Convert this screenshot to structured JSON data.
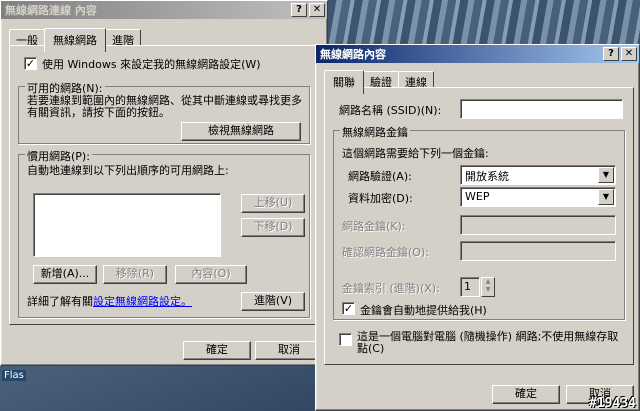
{
  "desktop": {
    "icon_label": "Flas",
    "watermark": "#19434"
  },
  "back_window": {
    "title": "無線網路連線 內容",
    "tabs": [
      "一般",
      "無線網路",
      "進階"
    ],
    "use_windows_checkbox": {
      "label": "使用 Windows 來設定我的無線網路設定(W)",
      "checked": true
    },
    "available_group": {
      "label": "可用的網路(N):",
      "text": "若要連線到範圍內的無線網路、從其中斷連線或尋找更多有關資訊，請按下面的按鈕。",
      "view_button": "檢視無線網路"
    },
    "preferred_group": {
      "label": "慣用網路(P):",
      "text": "自動地連線到以下列出順序的可用網路上:",
      "up_button": "上移(U)",
      "down_button": "下移(D)",
      "add_button": "新增(A)...",
      "remove_button": "移除(R)",
      "properties_button": "內容(O)"
    },
    "learn_prefix": "詳細了解有關",
    "learn_link": "設定無線網路設定。",
    "advanced_button": "進階(V)",
    "ok_button": "確定",
    "cancel_button": "取消"
  },
  "front_window": {
    "title": "無線網路內容",
    "tabs": [
      "關聯",
      "驗證",
      "連線"
    ],
    "ssid_label": "網路名稱 (SSID)(N):",
    "ssid_value": "",
    "key_group": {
      "label": "無線網路金鑰",
      "intro": "這個網路需要給下列一個金鑰:",
      "auth_label": "網路驗證(A):",
      "auth_value": "開放系統",
      "encrypt_label": "資料加密(D):",
      "encrypt_value": "WEP",
      "netkey_label": "網路金鑰(K):",
      "confirm_label": "確認網路金鑰(O):",
      "index_label": "金鑰索引 (進階)(X):",
      "index_value": "1",
      "auto_key_checkbox": {
        "label": "金鑰會自動地提供給我(H)",
        "checked": true
      }
    },
    "adhoc_checkbox": {
      "label": "這是一個電腦對電腦 (隨機操作) 網路;不使用無線存取點(C)",
      "checked": false
    },
    "ok_button": "確定",
    "cancel_button": "取消"
  }
}
